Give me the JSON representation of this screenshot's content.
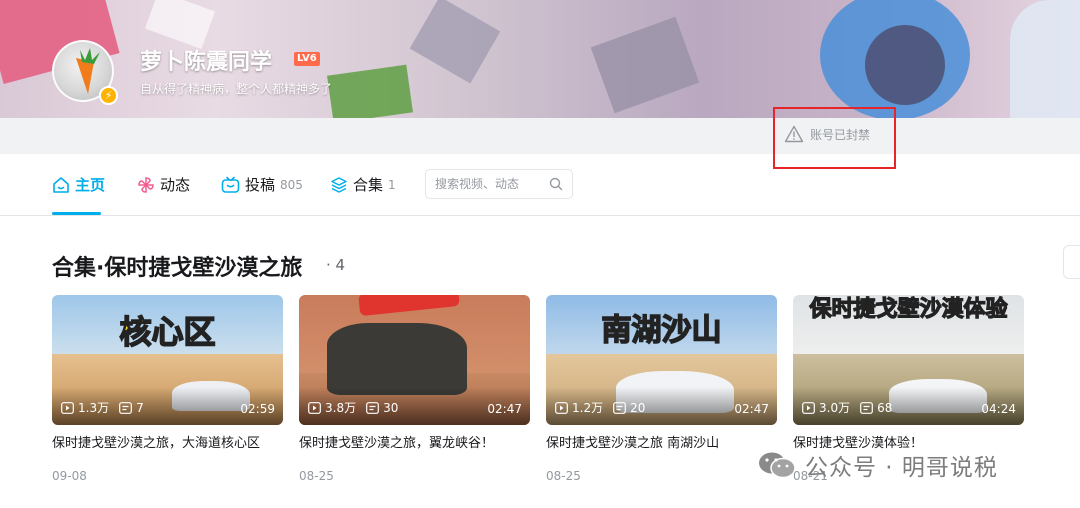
{
  "profile": {
    "username": "萝卜陈震同学",
    "level": "LV6",
    "sign": "自从得了精神病，整个人都精神多了",
    "status": "账号已封禁"
  },
  "nav": {
    "items": [
      {
        "label": "主页",
        "count": "",
        "icon": "home-icon"
      },
      {
        "label": "动态",
        "count": "",
        "icon": "windmill-icon"
      },
      {
        "label": "投稿",
        "count": "805",
        "icon": "tv-icon"
      },
      {
        "label": "合集",
        "count": "1",
        "icon": "layers-icon"
      }
    ],
    "search_placeholder": "搜索视频、动态"
  },
  "section": {
    "title": "合集·保时捷戈壁沙漠之旅",
    "count": "4"
  },
  "videos": [
    {
      "caption": "核心区",
      "views": "1.3万",
      "comments": "7",
      "duration": "02:59",
      "title": "保时捷戈壁沙漠之旅，大海道核心区",
      "date": "09-08"
    },
    {
      "caption": "",
      "views": "3.8万",
      "comments": "30",
      "duration": "02:47",
      "title": "保时捷戈壁沙漠之旅，翼龙峡谷！",
      "date": "08-25"
    },
    {
      "caption": "南湖沙山",
      "views": "1.2万",
      "comments": "20",
      "duration": "02:47",
      "title": "保时捷戈壁沙漠之旅 南湖沙山",
      "date": "08-25"
    },
    {
      "caption": "保时捷戈壁沙漠体验",
      "views": "3.0万",
      "comments": "68",
      "duration": "04:24",
      "title": "保时捷戈壁沙漠体验！",
      "date": "08-21"
    }
  ],
  "watermark": "公众号 · 明哥说税",
  "colors": {
    "accent": "#00aeec",
    "ban_box": "#e5252a",
    "level_badge": "#ff6a4b"
  }
}
